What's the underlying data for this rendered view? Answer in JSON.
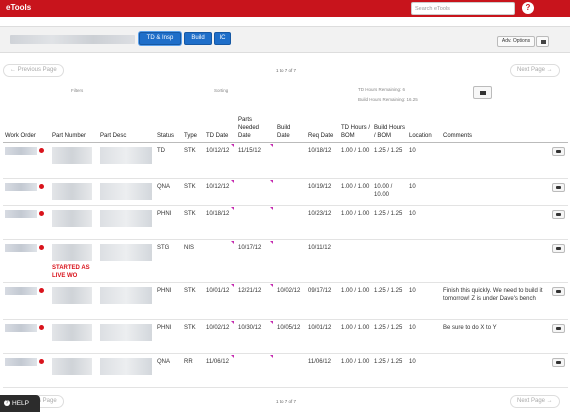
{
  "app": {
    "title": "eTools",
    "help_icon": "?"
  },
  "search": {
    "placeholder": "Search eTools"
  },
  "toolbar": {
    "buttons": [
      "TD & Insp",
      "Build",
      "IC"
    ],
    "adv_label": "Adv. Options"
  },
  "pager": {
    "prev": "← Previous Page",
    "next": "Next Page →",
    "info": "1 to 7 of 7"
  },
  "filters": {
    "filters_label": "Filters",
    "sorting_label": "Sorting",
    "td_hours": "TD Hours Remaining: 6",
    "build_hours": "Build Hours Remaining: 16.25"
  },
  "table": {
    "headers": [
      "Work Order",
      "Part Number",
      "Part Desc",
      "Status",
      "Type",
      "TD Date",
      "Parts Needed Date",
      "Build Date",
      "Req Date",
      "TD Hours / BOM",
      "Build Hours / BOM",
      "Location",
      "Comments"
    ],
    "rows": [
      {
        "status": "TD",
        "type": "STK",
        "td_date": "10/12/12",
        "parts_date": "11/15/12",
        "build_date": "",
        "req_date": "10/18/12",
        "td_hours": "1.00 / 1.00",
        "build_hours": "1.25 / 1.25",
        "location": "10",
        "comments": "",
        "live": ""
      },
      {
        "status": "QNA",
        "type": "STK",
        "td_date": "10/12/12",
        "parts_date": "",
        "build_date": "",
        "req_date": "10/19/12",
        "td_hours": "1.00 / 1.00",
        "build_hours": "10.00 / 10.00",
        "location": "10",
        "comments": "",
        "live": ""
      },
      {
        "status": "PHNI",
        "type": "STK",
        "td_date": "10/18/12",
        "parts_date": "",
        "build_date": "",
        "req_date": "10/23/12",
        "td_hours": "1.00 / 1.00",
        "build_hours": "1.25 / 1.25",
        "location": "10",
        "comments": "",
        "live": ""
      },
      {
        "status": "STG",
        "type": "NIS",
        "td_date": "",
        "parts_date": "10/17/12",
        "build_date": "",
        "req_date": "10/11/12",
        "td_hours": "",
        "build_hours": "",
        "location": "",
        "comments": "",
        "live": "STARTED AS LIVE WO"
      },
      {
        "status": "PHNI",
        "type": "STK",
        "td_date": "10/01/12",
        "parts_date": "12/21/12",
        "build_date": "10/02/12",
        "req_date": "09/17/12",
        "td_hours": "1.00 / 1.00",
        "build_hours": "1.25 / 1.25",
        "location": "10",
        "comments": "Finish this quickly. We need to build it tomorrow! Z is under Dave's bench",
        "live": ""
      },
      {
        "status": "PHNI",
        "type": "STK",
        "td_date": "10/02/12",
        "parts_date": "10/30/12",
        "build_date": "10/05/12",
        "req_date": "10/01/12",
        "td_hours": "1.00 / 1.00",
        "build_hours": "1.25 / 1.25",
        "location": "10",
        "comments": "Be sure to do X to Y",
        "live": ""
      },
      {
        "status": "QNA",
        "type": "RR",
        "td_date": "11/06/12",
        "parts_date": "",
        "build_date": "",
        "req_date": "11/06/12",
        "td_hours": "1.00 / 1.00",
        "build_hours": "1.25 / 1.25",
        "location": "10",
        "comments": "",
        "live": ""
      }
    ]
  },
  "help": {
    "label": "HELP"
  },
  "colors": {
    "brand": "#c8141c",
    "primary": "#1e6ec9",
    "date_pink": "#d12bd0",
    "alert": "#d9131c"
  }
}
